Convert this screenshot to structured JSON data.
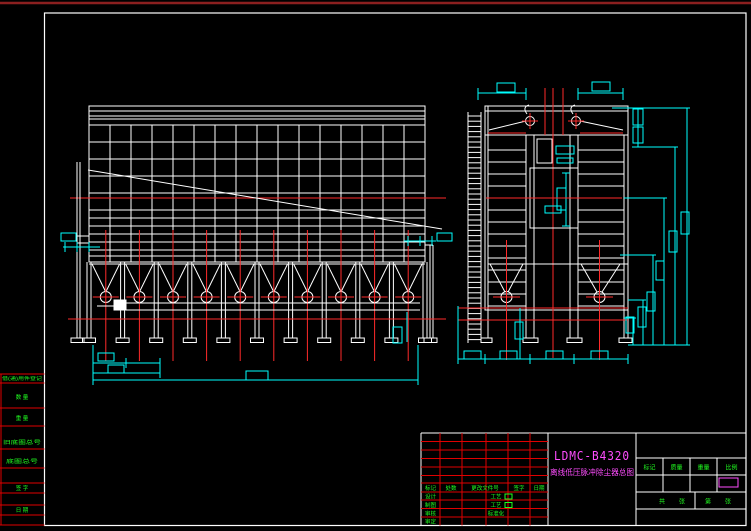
{
  "drawing": {
    "model": "LDMC-B4320",
    "drawing_title": "离线低压脉冲除尘器总图"
  },
  "title_block": {
    "revision_header": [
      "标记",
      "处数",
      "更改文件号",
      "签字",
      "日期"
    ],
    "sig_labels": [
      "设计",
      "制图",
      "审核",
      "审定"
    ],
    "proc_labels": [
      "工艺",
      "工艺",
      "标准化"
    ],
    "info_headers": [
      "标记",
      "质量",
      "重量",
      "比例"
    ],
    "sheet_labels": [
      "共",
      "张",
      "第",
      "张"
    ]
  },
  "left_margin": {
    "rows": [
      "借(通)用件登记",
      "数  量",
      "重  量",
      "旧底图总号",
      "底图总号",
      "签  字",
      "日  期"
    ]
  },
  "colors": {
    "background": "#000000",
    "line_white": "#ffffff",
    "red": "#ff2a2a",
    "table_red": "#e00000",
    "dark_red_top": "#8b1f1f",
    "cyan": "#00ffff",
    "green": "#21ff21",
    "magenta": "#ff4dff"
  }
}
